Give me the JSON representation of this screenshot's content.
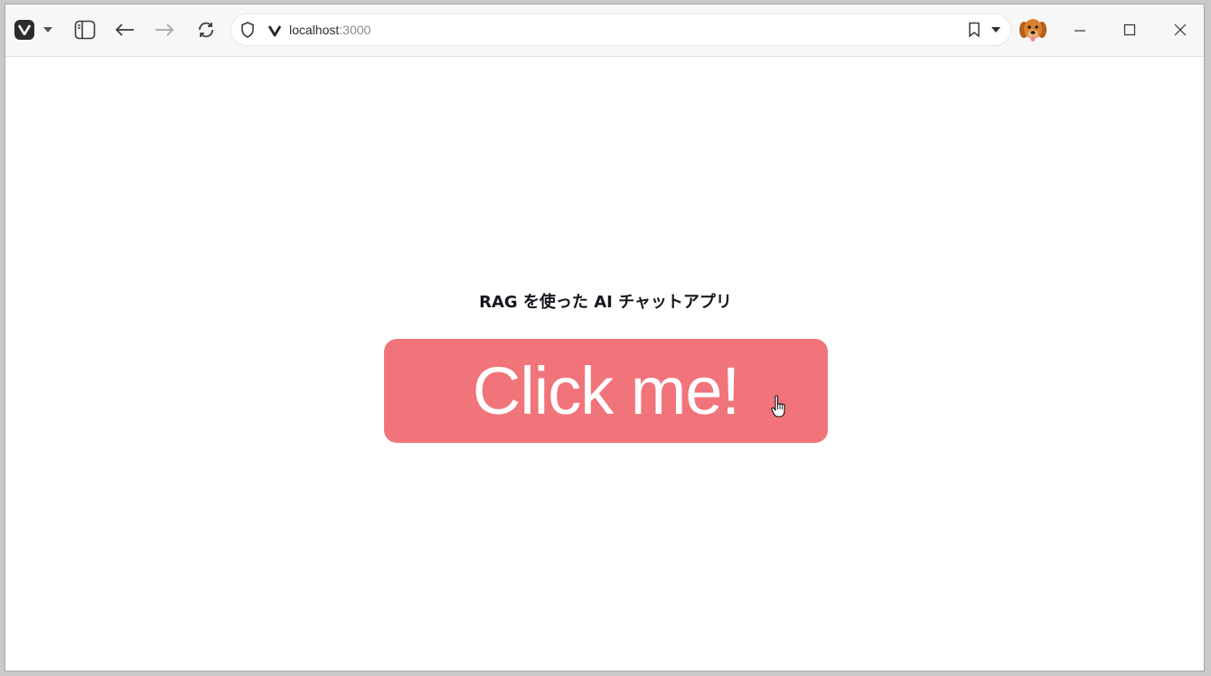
{
  "browser": {
    "url_host": "localhost",
    "url_port": ":3000",
    "icons": {
      "logo": "vivaldi-logo-icon",
      "menu": "chevron-down-icon",
      "panel": "sidebar-panel-icon",
      "back": "arrow-left-icon",
      "forward": "arrow-right-icon",
      "reload": "reload-icon",
      "security": "shield-icon",
      "site": "vivaldi-v-icon",
      "bookmark": "bookmark-icon",
      "dropdown": "caret-down-icon",
      "profile": "dog-avatar",
      "minimize": "minimize-icon",
      "maximize": "maximize-icon",
      "close": "close-icon"
    }
  },
  "page": {
    "title": "RAG を使った AI チャットアプリ",
    "button_label": "Click me!"
  },
  "colors": {
    "button_bg": "#f1747b",
    "button_text": "#ffffff",
    "title_text": "#16161e"
  }
}
